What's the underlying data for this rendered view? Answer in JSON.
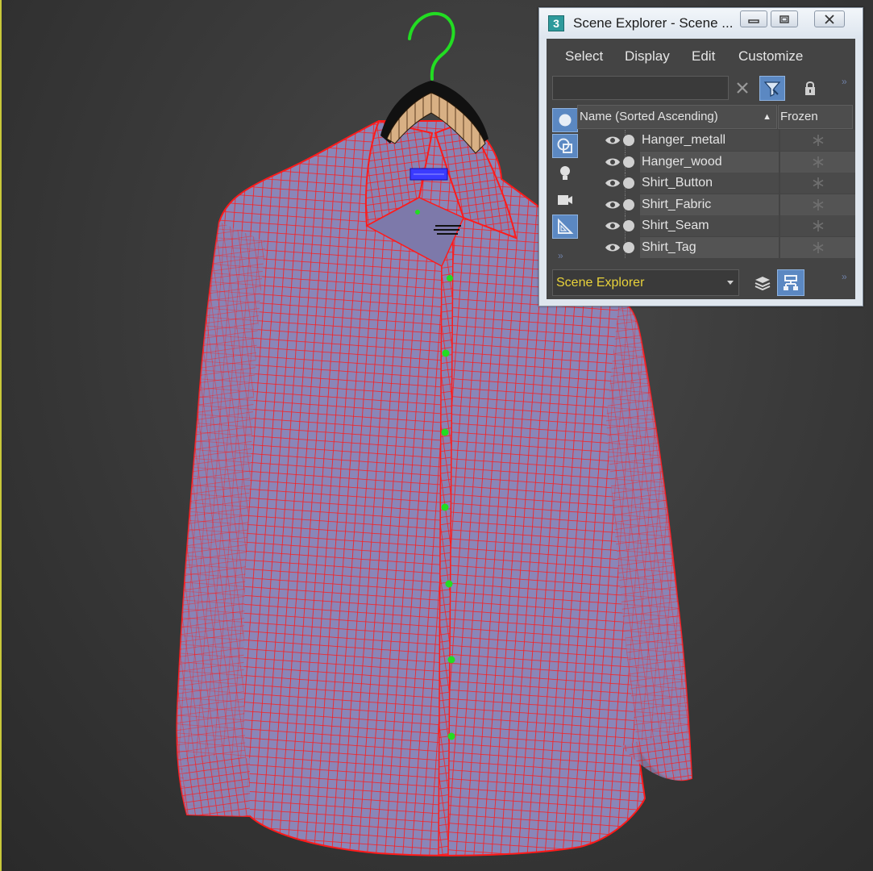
{
  "window": {
    "app_icon_text": "3",
    "title": "Scene Explorer - Scene ..."
  },
  "menu": [
    "Select",
    "Display",
    "Edit",
    "Customize"
  ],
  "search": {
    "value": "",
    "placeholder": ""
  },
  "columns": {
    "name": "Name (Sorted Ascending)",
    "sort_indicator": "▲",
    "frozen": "Frozen"
  },
  "objects": [
    {
      "name": "Hanger_metall"
    },
    {
      "name": "Hanger_wood"
    },
    {
      "name": "Shirt_Button"
    },
    {
      "name": "Shirt_Fabric"
    },
    {
      "name": "Shirt_Seam"
    },
    {
      "name": "Shirt_Tag"
    }
  ],
  "explorer_dropdown": {
    "selected": "Scene Explorer"
  },
  "colors": {
    "viewport_bg": "#3b3b3b",
    "wireframe": "#ff1a1a",
    "shirt_fill": "#8a86b8",
    "hanger_hook": "#22dd22",
    "hanger_wood": "#d8b084",
    "dropdown_text": "#e8d23a",
    "active_button": "#5b88c2"
  },
  "icons": {
    "clear_search": "x-icon",
    "filter": "filter-icon",
    "lock": "lock-icon",
    "rail": [
      "geometry-icon",
      "shapes-icon",
      "light-icon",
      "camera-icon",
      "helper-icon"
    ],
    "bottom": [
      "layers-icon",
      "hierarchy-icon"
    ]
  }
}
